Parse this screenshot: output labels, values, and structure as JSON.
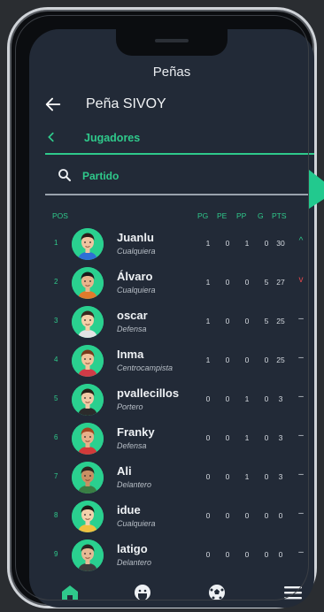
{
  "app": {
    "title": "Peñas"
  },
  "header": {
    "title": "Peña SIVOY",
    "back_icon": "arrow-left-icon"
  },
  "section": {
    "label": "Jugadores",
    "chevron_icon": "chevron-left-icon"
  },
  "search": {
    "value": "Partido",
    "icon": "search-icon"
  },
  "columns": {
    "pos": "POS",
    "pg": "PG",
    "pe": "PE",
    "pp": "PP",
    "g": "G",
    "pts": "PTS"
  },
  "colors": {
    "accent": "#2fc98b",
    "background": "#222a37",
    "up": "#2fc98b",
    "down": "#e2484c"
  },
  "players": [
    {
      "pos": "1",
      "name": "Juanlu",
      "role": "Cualquiera",
      "pg": "1",
      "pe": "0",
      "pp": "1",
      "g": "0",
      "pts": "30",
      "trend": "^",
      "trend_type": "up"
    },
    {
      "pos": "2",
      "name": "Álvaro",
      "role": "Cualquiera",
      "pg": "1",
      "pe": "0",
      "pp": "0",
      "g": "5",
      "pts": "27",
      "trend": "v",
      "trend_type": "down"
    },
    {
      "pos": "3",
      "name": "oscar",
      "role": "Defensa",
      "pg": "1",
      "pe": "0",
      "pp": "0",
      "g": "5",
      "pts": "25",
      "trend": "–",
      "trend_type": "same"
    },
    {
      "pos": "4",
      "name": "Inma",
      "role": "Centrocampista",
      "pg": "1",
      "pe": "0",
      "pp": "0",
      "g": "0",
      "pts": "25",
      "trend": "–",
      "trend_type": "same"
    },
    {
      "pos": "5",
      "name": "pvallecillos",
      "role": "Portero",
      "pg": "0",
      "pe": "0",
      "pp": "1",
      "g": "0",
      "pts": "3",
      "trend": "–",
      "trend_type": "same"
    },
    {
      "pos": "6",
      "name": "Franky",
      "role": "Defensa",
      "pg": "0",
      "pe": "0",
      "pp": "1",
      "g": "0",
      "pts": "3",
      "trend": "–",
      "trend_type": "same"
    },
    {
      "pos": "7",
      "name": "Ali",
      "role": "Delantero",
      "pg": "0",
      "pe": "0",
      "pp": "1",
      "g": "0",
      "pts": "3",
      "trend": "–",
      "trend_type": "same"
    },
    {
      "pos": "8",
      "name": "idue",
      "role": "Cualquiera",
      "pg": "0",
      "pe": "0",
      "pp": "0",
      "g": "0",
      "pts": "0",
      "trend": "–",
      "trend_type": "same"
    },
    {
      "pos": "9",
      "name": "latigo",
      "role": "Delantero",
      "pg": "0",
      "pe": "0",
      "pp": "0",
      "g": "0",
      "pts": "0",
      "trend": "–",
      "trend_type": "same"
    }
  ],
  "nav": {
    "items": [
      "home-icon",
      "player-icon",
      "football-icon",
      "menu-icon"
    ]
  }
}
